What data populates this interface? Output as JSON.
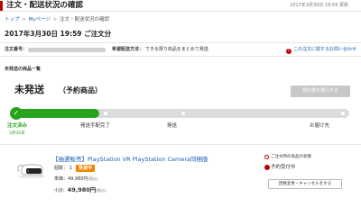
{
  "header": {
    "title": "注文・配送状況の確認",
    "timestamp": "2017年3月30日 19:59 更新"
  },
  "breadcrumb": {
    "items": [
      "トップ",
      "Myページ",
      "注文・配送状況の確認"
    ],
    "separator": ">"
  },
  "order": {
    "date_text": "2017年3月30日 19:59 ご注文分",
    "number_label": "注文番号：",
    "delivery_label": "希望配送方法：",
    "delivery_value": "できる限り商品をまとめて発送",
    "inquiry_link": "この注文に関するお問い合わせ"
  },
  "section": {
    "label": "未発送の商品一覧"
  },
  "status": {
    "main": "未発送",
    "sub": "（予約商品）",
    "receipt_button": "領収書を発行する"
  },
  "progress": {
    "completed_fraction": 0.25,
    "steps": [
      {
        "label": "注文済み",
        "date": "3月30日"
      },
      {
        "label": "発送手配完了",
        "date": ""
      },
      {
        "label": "発送",
        "date": ""
      },
      {
        "label": "お届け先",
        "date": ""
      }
    ]
  },
  "product": {
    "title": "【抽選販売】PlayStation VR PlayStation Camera同梱版",
    "qty_text": "個数：  1",
    "badge": "受渡中",
    "price_text": "単価：49,980円",
    "price_tax": "(税込)",
    "subtotal_label": "小計:",
    "subtotal_value": "49,980円",
    "subtotal_tax": "(税込)"
  },
  "right_panel": {
    "title": "ご注文時の商品の状態",
    "status": "予約受付中",
    "button": "回数変更・キャンセルをする"
  },
  "colors": {
    "brand_red": "#bf0000",
    "progress_green": "#27a41c",
    "badge_orange": "#f08400",
    "link_blue": "#1a5fb4"
  }
}
